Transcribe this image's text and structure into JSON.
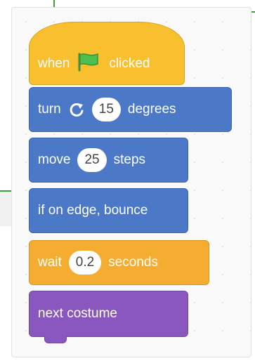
{
  "blocks": {
    "hat": {
      "when": "when",
      "clicked": "clicked",
      "flag_icon": "green-flag-icon"
    },
    "turn": {
      "label": "turn",
      "value": "15",
      "suffix": "degrees",
      "icon": "rotate-right-icon"
    },
    "move": {
      "label": "move",
      "value": "25",
      "suffix": "steps"
    },
    "bounce": {
      "label": "if on edge, bounce"
    },
    "wait": {
      "label": "wait",
      "value": "0.2",
      "suffix": "seconds"
    },
    "costume": {
      "label": "next costume"
    }
  },
  "colors": {
    "events": "#f8bf2f",
    "motion": "#4c78c8",
    "control": "#f5ad31",
    "looks": "#8a57bf",
    "flag": "#4cbf4c"
  }
}
